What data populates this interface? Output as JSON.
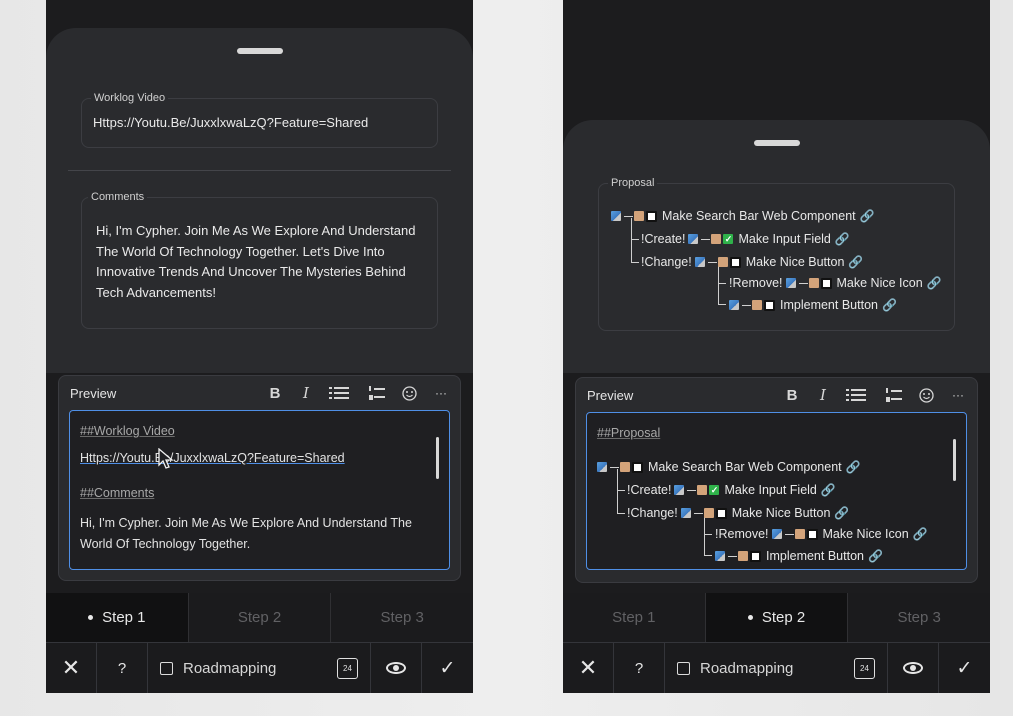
{
  "left": {
    "worklog": {
      "label": "Worklog Video",
      "value": "Https://Youtu.Be/JuxxlxwaLzQ?Feature=Shared"
    },
    "comments": {
      "label": "Comments",
      "value": "Hi, I'm Cypher. Join Me As We Explore And Understand The World Of Technology Together. Let's Dive Into Innovative Trends And Uncover The Mysteries Behind Tech Advancements!"
    },
    "editor": {
      "label": "Preview",
      "heading1": "##Worklog Video",
      "link": "Https://Youtu.Be/JuxxlxwaLzQ?Feature=Shared",
      "heading2": "##Comments",
      "text": "Hi, I'm Cypher. Join Me As We Explore And Understand The World Of Technology Together."
    },
    "steps": [
      "Step 1",
      "Step 2",
      "Step 3"
    ],
    "active_step": 0
  },
  "right": {
    "proposal": {
      "label": "Proposal"
    },
    "editor": {
      "label": "Preview",
      "heading": "##Proposal"
    },
    "steps": [
      "Step 1",
      "Step 2",
      "Step 3"
    ],
    "active_step": 1
  },
  "tree": {
    "root": "Make Search Bar Web Component",
    "create_label": "!Create!",
    "create_item": "Make Input Field",
    "change_label": "!Change!",
    "change_item": "Make Nice Button",
    "remove_label": "!Remove!",
    "remove_item": "Make Nice Icon",
    "implement_item": "Implement Button"
  },
  "toolbar": {
    "bold": "B",
    "italic": "I",
    "more": "···"
  },
  "bottombar": {
    "close": "✕",
    "help": "?",
    "roadmapping": "Roadmapping",
    "calendar": "24",
    "confirm": "✓"
  }
}
